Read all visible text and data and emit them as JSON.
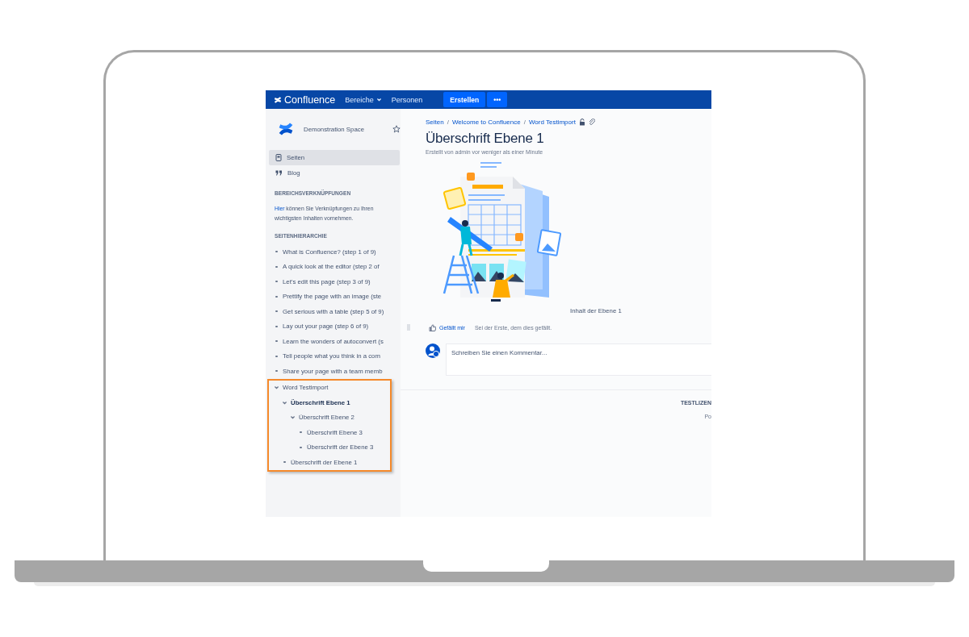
{
  "topbar": {
    "logo": "Confluence",
    "menu": [
      {
        "label": "Bereiche",
        "dropdown": true
      },
      {
        "label": "Personen",
        "dropdown": false
      }
    ],
    "create_button": "Erstellen",
    "more_button": "•••"
  },
  "sidebar": {
    "space_name": "Demonstration Space",
    "nav": [
      {
        "label": "Seiten",
        "kind": "page",
        "selected": true
      },
      {
        "label": "Blog",
        "kind": "quote",
        "selected": false
      }
    ],
    "shortcuts_heading": "BEREICHSVERKNÜPFUNGEN",
    "shortcuts_link": "Hier",
    "shortcuts_text": "können Sie Verknüpfungen zu Ihren wichtigsten Inhalten vornehmen.",
    "hierarchy_heading": "SEITENHIERARCHIE",
    "tree": [
      {
        "label": "What is Confluence? (step 1 of 9)",
        "selected": false,
        "highlighted": false
      },
      {
        "label": "A quick look at the editor (step 2 of",
        "selected": false,
        "highlighted": false
      },
      {
        "label": "Let’s edit this page (step 3 of 9)",
        "selected": false,
        "highlighted": false
      },
      {
        "label": "Prettify the page with an image (ste",
        "selected": false,
        "highlighted": false
      },
      {
        "label": "Get serious with a table (step 5 of 9)",
        "selected": false,
        "highlighted": false
      },
      {
        "label": "Lay out your page (step 6 of 9)",
        "selected": false,
        "highlighted": false
      },
      {
        "label": "Learn the wonders of autoconvert (s",
        "selected": false,
        "highlighted": false
      },
      {
        "label": "Tell people what you think in a com",
        "selected": false,
        "highlighted": false
      },
      {
        "label": "Share your page with a team memb",
        "selected": false,
        "highlighted": false
      },
      {
        "label": "Word Testimport",
        "selected": false,
        "highlighted": true,
        "expanded": true,
        "children": [
          {
            "label": "Überschrift Ebene 1",
            "selected": true,
            "highlighted": false,
            "expanded": true,
            "children": [
              {
                "label": "Überschrift Ebene 2",
                "selected": false,
                "highlighted": false,
                "expanded": true,
                "children": [
                  {
                    "label": "Überschrift Ebene 3",
                    "selected": false,
                    "highlighted": false
                  },
                  {
                    "label": "Überschrift der Ebene 3",
                    "selected": false,
                    "highlighted": false
                  }
                ]
              }
            ]
          },
          {
            "label": "Überschrift der Ebene 1",
            "selected": false,
            "highlighted": false
          }
        ]
      }
    ]
  },
  "main": {
    "breadcrumbs": [
      "Seiten",
      "Welcome to Confluence",
      "Word Testimport"
    ],
    "breadcrumb_separators": [
      "/",
      "/"
    ],
    "title": "Überschrift Ebene 1",
    "byline": "Erstellt von admin vor weniger als einer Minute",
    "content": "Inhalt der Ebene 1",
    "like": {
      "label": "Gefällt mir",
      "text": "Sei der Erste, dem dies gefällt."
    },
    "comment": {
      "placeholder": "Schreiben Sie einen Kommentar..."
    },
    "footer": [
      "TESTLIZEN",
      "Po"
    ]
  }
}
